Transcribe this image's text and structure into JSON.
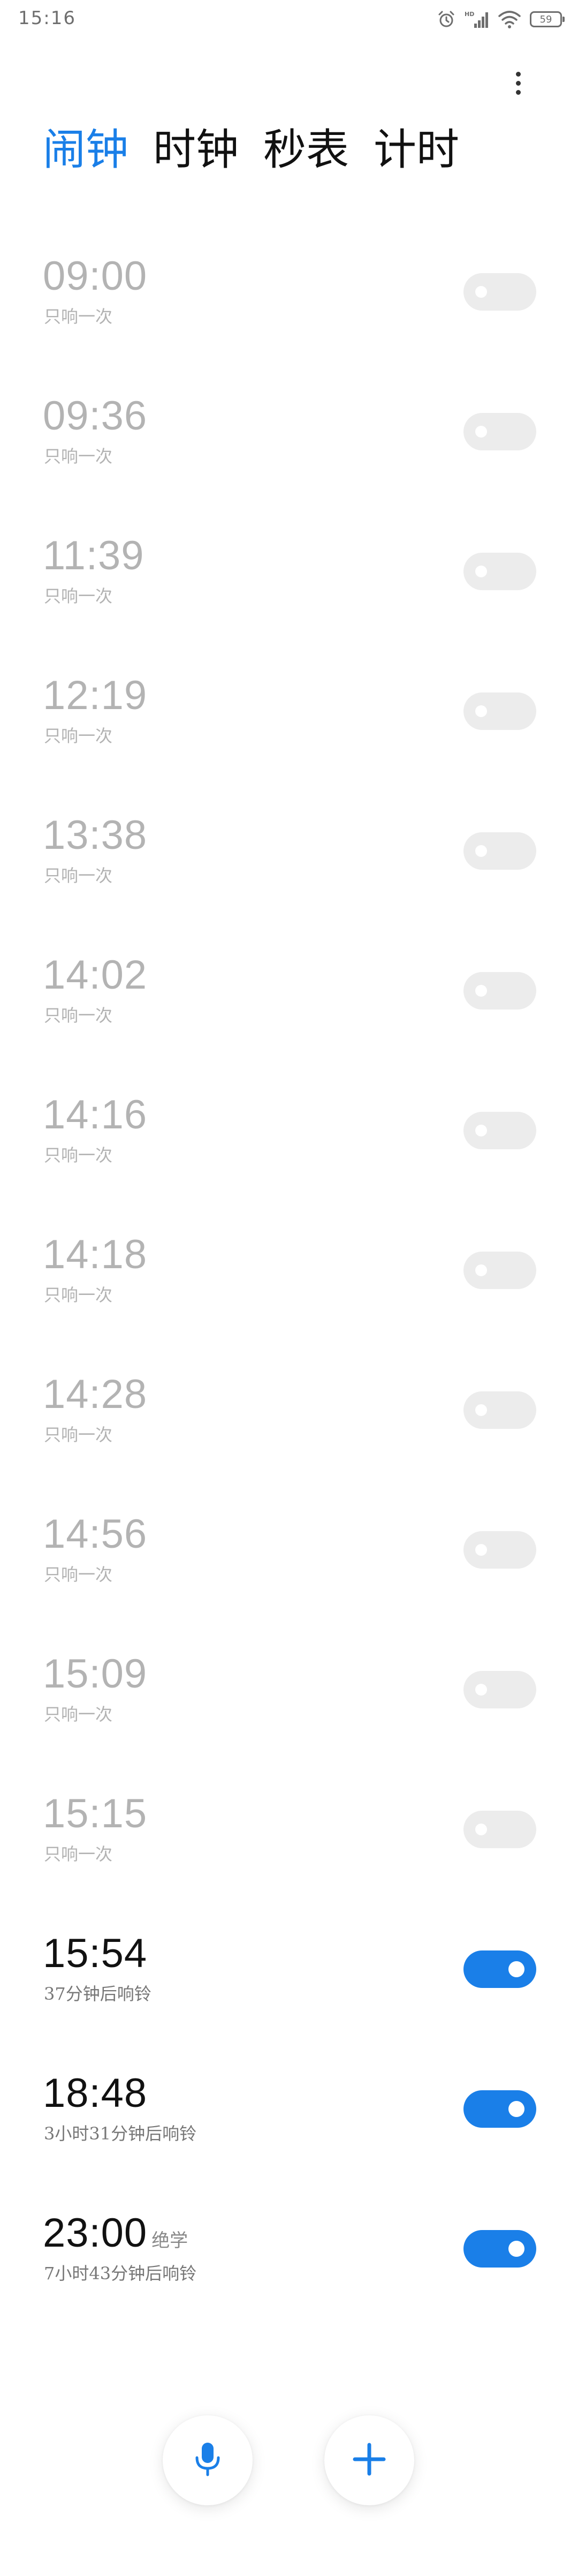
{
  "status_bar": {
    "time": "15:16",
    "icons": [
      "alarm-icon",
      "hd-signal-icon",
      "wifi-icon",
      "battery-icon"
    ],
    "battery_label": "59"
  },
  "menu": {
    "icon": "more-vertical-icon"
  },
  "tabs": [
    {
      "label": "闹钟",
      "active": true
    },
    {
      "label": "时钟",
      "active": false
    },
    {
      "label": "秒表",
      "active": false
    },
    {
      "label": "计时",
      "active": false
    }
  ],
  "alarms": [
    {
      "time": "09:00",
      "name": "",
      "subtitle": "只响一次",
      "enabled": false
    },
    {
      "time": "09:36",
      "name": "",
      "subtitle": "只响一次",
      "enabled": false
    },
    {
      "time": "11:39",
      "name": "",
      "subtitle": "只响一次",
      "enabled": false
    },
    {
      "time": "12:19",
      "name": "",
      "subtitle": "只响一次",
      "enabled": false
    },
    {
      "time": "13:38",
      "name": "",
      "subtitle": "只响一次",
      "enabled": false
    },
    {
      "time": "14:02",
      "name": "",
      "subtitle": "只响一次",
      "enabled": false
    },
    {
      "time": "14:16",
      "name": "",
      "subtitle": "只响一次",
      "enabled": false
    },
    {
      "time": "14:18",
      "name": "",
      "subtitle": "只响一次",
      "enabled": false
    },
    {
      "time": "14:28",
      "name": "",
      "subtitle": "只响一次",
      "enabled": false
    },
    {
      "time": "14:56",
      "name": "",
      "subtitle": "只响一次",
      "enabled": false
    },
    {
      "time": "15:09",
      "name": "",
      "subtitle": "只响一次",
      "enabled": false
    },
    {
      "time": "15:15",
      "name": "",
      "subtitle": "只响一次",
      "enabled": false
    },
    {
      "time": "15:54",
      "name": "",
      "subtitle": "37分钟后响铃",
      "enabled": true
    },
    {
      "time": "18:48",
      "name": "",
      "subtitle": "3小时31分钟后响铃",
      "enabled": true
    },
    {
      "time": "23:00",
      "name": "绝学",
      "subtitle": "7小时43分钟后响铃",
      "enabled": true
    }
  ],
  "fabs": {
    "voice_icon": "microphone-icon",
    "add_icon": "plus-icon"
  },
  "colors": {
    "accent": "#1a7fe8",
    "toggle_off": "#ececec",
    "text_disabled": "#b3b3b3",
    "text_primary": "#111111"
  }
}
